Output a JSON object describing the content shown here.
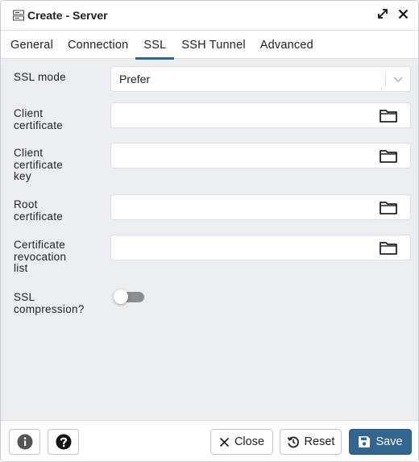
{
  "window": {
    "title": "Create - Server",
    "server_icon": "server-icon",
    "maximize_icon": "expand-icon",
    "close_icon": "close-icon"
  },
  "tabs": [
    {
      "label": "General",
      "active": false
    },
    {
      "label": "Connection",
      "active": false
    },
    {
      "label": "SSL",
      "active": true
    },
    {
      "label": "SSH Tunnel",
      "active": false
    },
    {
      "label": "Advanced",
      "active": false
    }
  ],
  "fields": {
    "ssl_mode": {
      "label": "SSL mode",
      "value": "Prefer"
    },
    "client_certificate": {
      "label_lines": [
        "Client",
        "certificate"
      ],
      "value": ""
    },
    "client_certificate_key": {
      "label_lines": [
        "Client",
        "certificate",
        "key"
      ],
      "value": ""
    },
    "root_certificate": {
      "label_lines": [
        "Root",
        "certificate"
      ],
      "value": ""
    },
    "certificate_revocation_list": {
      "label_lines": [
        "Certificate",
        "revocation",
        "list"
      ],
      "value": ""
    },
    "ssl_compression": {
      "label_lines": [
        "SSL",
        "compression?"
      ],
      "enabled": false
    }
  },
  "footer": {
    "info_icon": "info-icon",
    "help_icon": "help-icon",
    "close_label": "Close",
    "reset_label": "Reset",
    "save_label": "Save"
  },
  "colors": {
    "accent": "#326690",
    "background": "#ebedf0"
  }
}
